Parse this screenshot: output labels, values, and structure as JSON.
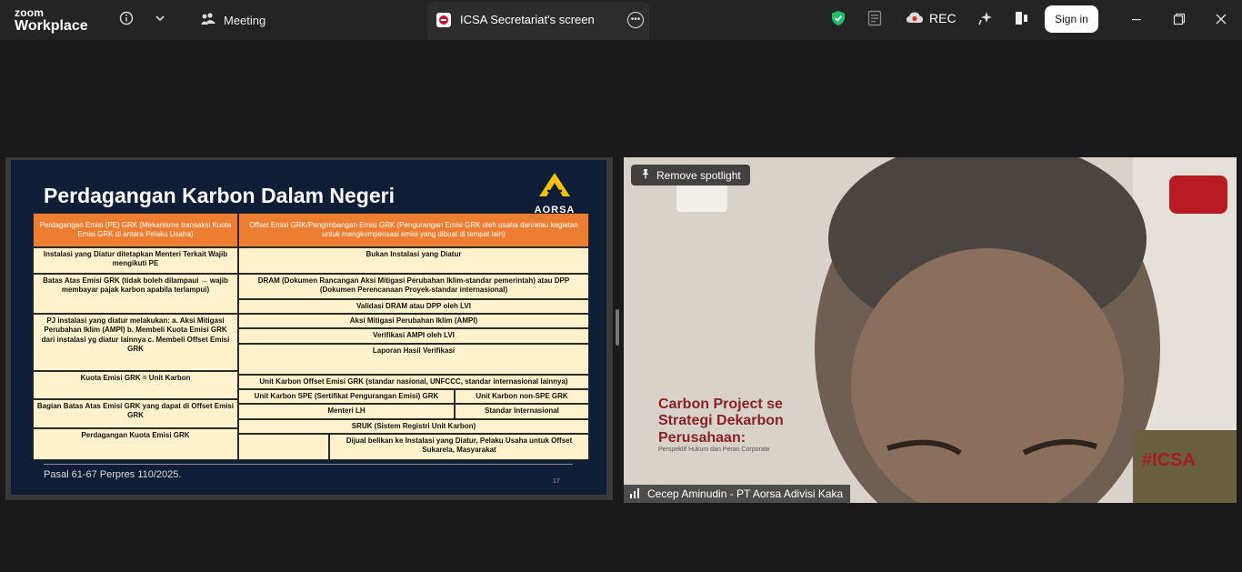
{
  "app": {
    "brand_top": "zoom",
    "brand_bottom": "Workplace"
  },
  "toolbar": {
    "meeting_label": "Meeting",
    "tab_title": "ICSA Secretariat's screen",
    "rec_label": "REC",
    "signin_label": "Sign in"
  },
  "icons": {
    "info": "info-icon",
    "chevron": "chevron-down-icon",
    "meeting": "people-icon",
    "shield": "shield-check-icon",
    "notes": "notes-icon",
    "cloud": "cloud-record-icon",
    "ai": "ai-sparkle-icon",
    "share": "share-screen-icon",
    "minimize": "minimize-icon",
    "restore": "restore-icon",
    "close": "close-icon"
  },
  "colors": {
    "shield": "#1fbf66",
    "rec": "#e02a2a",
    "slide_bg": "#0f1e36",
    "table_header": "#ed7d31",
    "table_body": "#fff2cc"
  },
  "slide": {
    "title": "Perdagangan Karbon Dalam Negeri",
    "logo_text": "AORSA",
    "footer": "Pasal 61-67 Perpres 110/2025.",
    "page": "17",
    "header_left": "Perdagangan Emisi (PE) GRK (Mekanisme transaksi Kuota Emisi GRK di antara Pelaku Usaha)",
    "header_right": "Offset Emisi GRK/Pengimbangan Emisi GRK (Pengurangan Emisi GRK oleh usaha dan/atau kegiatan untuk mengkompensasi emisi yang dibuat di tempat lain)",
    "left_cells": [
      "Instalasi yang Diatur ditetapkan Menteri Terkait Wajib mengikuti PE",
      "Batas Atas Emisi GRK (tidak boleh dilampaui → wajib membayar pajak karbon apabila terlampui)",
      "PJ instalasi yang diatur melakukan: a. Aksi Mitigasi Perubahan Iklim (AMPI) b. Membeli Kuota Emisi GRK dari instalasi yg diatur lainnya c. Membeli Offset Emisi GRK",
      "Kuota Emisi GRK = Unit Karbon",
      "Bagian Batas Atas Emisi GRK yang dapat di Offset Emisi GRK",
      "Perdagangan Kuota Emisi GRK"
    ],
    "right_cells": [
      "Bukan Instalasi yang Diatur",
      "DRAM (Dokumen Rancangan Aksi Mitigasi Perubahan Iklim-standar pemerintah) atau DPP (Dokumen Perencanaan Proyek-standar internasional)",
      "Validasi DRAM atau DPP oleh LVI",
      "Aksi Mitigasi Perubahan Iklim (AMPI)",
      "Verifikasi AMPI oleh LVI",
      "Laporan Hasil Verifikasi",
      "Unit Karbon Offset Emisi GRK (standar nasional, UNFCCC, standar internasional lainnya)",
      "Unit Karbon SPE (Sertifikat Pengurangan Emisi) GRK",
      "Unit Karbon non-SPE GRK",
      "Menteri LH",
      "Standar Internasional",
      "SRUK (Sistem Registri Unit Karbon)",
      "Dijual belikan ke Instalasi yang Diatur, Pelaku Usaha untuk Offset Sukarela, Masyarakat"
    ]
  },
  "video": {
    "spotlight_label": "Remove spotlight",
    "participant_name": "Cecep Aminudin - PT Aorsa Adivisi Kaka",
    "banner_line1": "Carbon Project se",
    "banner_line2": "Strategi Dekarbon",
    "banner_line3": "Perusahaan:",
    "banner_sub": "Perspektif Hukum dan Peran Corporate",
    "hashtag": "#ICSA"
  }
}
